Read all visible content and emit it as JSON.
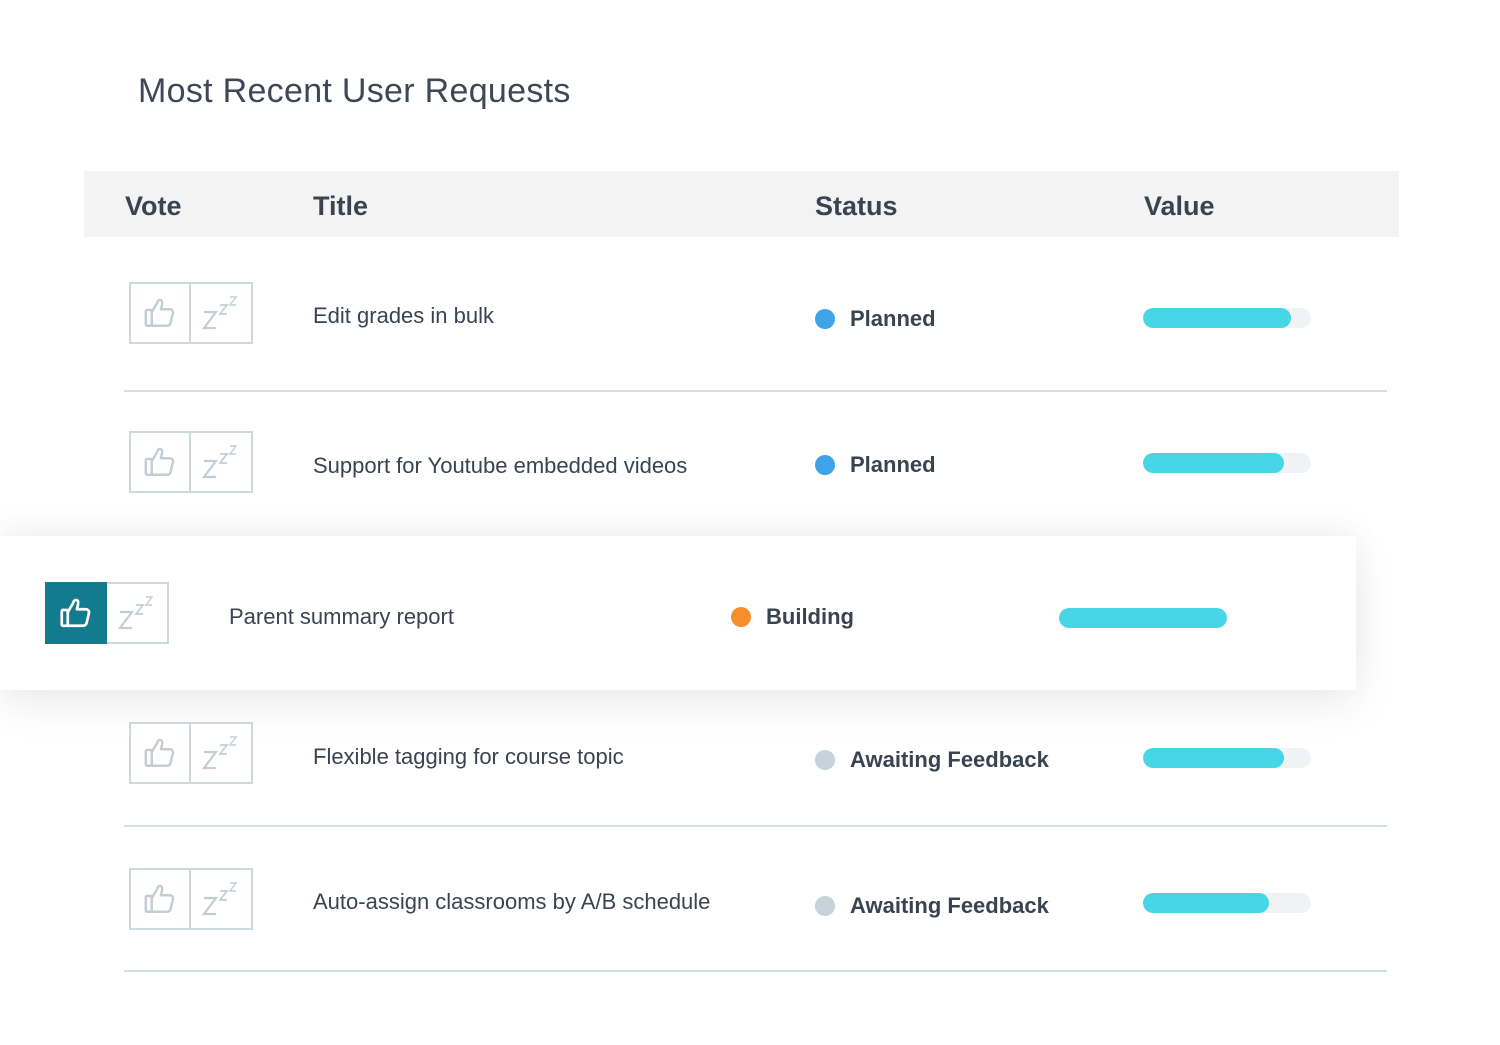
{
  "page": {
    "title": "Most Recent User Requests"
  },
  "table": {
    "headers": {
      "vote": "Vote",
      "title": "Title",
      "status": "Status",
      "value": "Value"
    },
    "rows": [
      {
        "title": "Edit grades in bulk",
        "status": "Planned",
        "status_color": "#3ea3e8",
        "value": 0.88,
        "upvoted": false
      },
      {
        "title": "Support for Youtube embedded videos",
        "status": "Planned",
        "status_color": "#3ea3e8",
        "value": 0.84,
        "upvoted": false
      },
      {
        "title": "Parent summary report",
        "status": "Building",
        "status_color": "#f78e2c",
        "value": 1.0,
        "upvoted": true
      },
      {
        "title": "Flexible tagging for course topic",
        "status": "Awaiting Feedback",
        "status_color": "#c6d3da",
        "value": 0.84,
        "upvoted": false
      },
      {
        "title": "Auto-assign classrooms by A/B schedule",
        "status": "Awaiting Feedback",
        "status_color": "#c6d3da",
        "value": 0.75,
        "upvoted": false
      }
    ]
  },
  "icons": {
    "upvote": "thumbs-up-icon",
    "snooze": "snooze-icon"
  },
  "colors": {
    "accent": "#137b8e",
    "value_bar": "#47d6e6",
    "track": "#f0f2f3"
  }
}
